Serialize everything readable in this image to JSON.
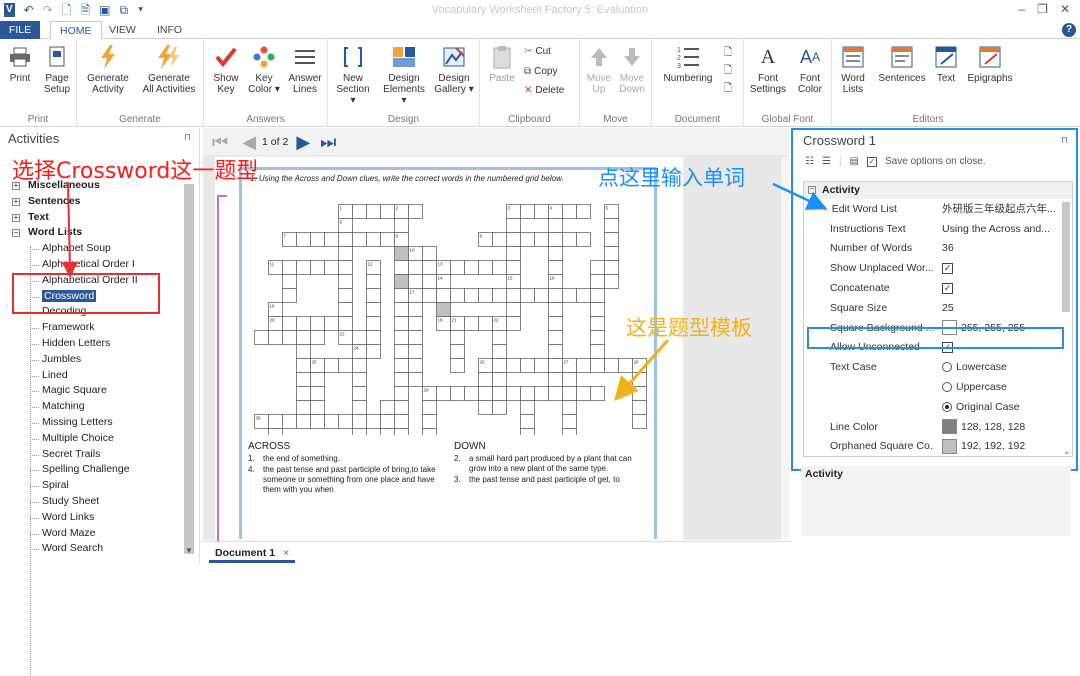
{
  "window": {
    "title": "Vocabulary Worksheet Factory 5: Evaluation"
  },
  "tabs": {
    "file": "FILE",
    "home": "HOME",
    "view": "VIEW",
    "info": "INFO"
  },
  "ribbon": {
    "print": {
      "label": "Print",
      "group": "Print"
    },
    "page_setup": {
      "line1": "Page",
      "line2": "Setup"
    },
    "generate_activity": {
      "line1": "Generate",
      "line2": "Activity"
    },
    "generate_all": {
      "line1": "Generate",
      "line2": "All Activities"
    },
    "generate_group": "Generate",
    "show_key": {
      "line1": "Show",
      "line2": "Key"
    },
    "key_color": {
      "line1": "Key",
      "line2": "Color ▾"
    },
    "answer_lines": {
      "line1": "Answer",
      "line2": "Lines"
    },
    "answers_group": "Answers",
    "new_section": {
      "line1": "New",
      "line2": "Section ▾"
    },
    "design_elements": {
      "line1": "Design",
      "line2": "Elements ▾"
    },
    "design_gallery": {
      "line1": "Design",
      "line2": "Gallery ▾"
    },
    "design_group": "Design",
    "paste": "Paste",
    "cut": "Cut",
    "copy": "Copy",
    "delete": "Delete",
    "clipboard_group": "Clipboard",
    "move_up": {
      "line1": "Move",
      "line2": "Up"
    },
    "move_down": {
      "line1": "Move",
      "line2": "Down"
    },
    "move_group": "Move",
    "numbering": "Numbering",
    "document_group": "Document",
    "font_settings": {
      "line1": "Font",
      "line2": "Settings"
    },
    "font_color": {
      "line1": "Font",
      "line2": "Color"
    },
    "global_font_group": "Global Font",
    "word_lists": {
      "line1": "Word",
      "line2": "Lists"
    },
    "sentences": "Sentences",
    "text": "Text",
    "epigraphs": "Epigraphs",
    "editors_group": "Editors"
  },
  "activities": {
    "title": "Activities",
    "top_nodes": [
      "Miscellaneous",
      "Sentences",
      "Text",
      "Word Lists"
    ],
    "items": [
      "Alphabet Soup",
      "Alphabetical Order I",
      "Alphabetical Order II",
      "Crossword",
      "Decoding",
      "Framework",
      "Hidden Letters",
      "Jumbles",
      "Lined",
      "Magic Square",
      "Matching",
      "Missing Letters",
      "Multiple Choice",
      "Secret Trails",
      "Spelling Challenge",
      "Spiral",
      "Study Sheet",
      "Word Links",
      "Word Maze",
      "Word Search"
    ],
    "selected": "Crossword"
  },
  "navigation": {
    "page": "1 of 2"
  },
  "worksheet": {
    "instructions": "1.   Using the Across and Down clues, write the correct words in the numbered grid below.",
    "across_title": "ACROSS",
    "down_title": "DOWN",
    "across": [
      {
        "n": "1.",
        "t": "the end of something."
      },
      {
        "n": "4.",
        "t": "the past tense and past participle of bring,to take someone or something from one place and have them with you when"
      }
    ],
    "down": [
      {
        "n": "2.",
        "t": "a small hard part produced by a plant that can grow into a new plant of the same type."
      },
      {
        "n": "3.",
        "t": "the past tense and past participle of get, to"
      }
    ]
  },
  "document_tab": "Document 1",
  "properties": {
    "title": "Crossword 1",
    "save_options": "Save options on close.",
    "category": "Activity",
    "rows": [
      {
        "name": "Edit Word List",
        "value": "外研版三年级起点六年..."
      },
      {
        "name": "Instructions Text",
        "value": "Using the Across and..."
      },
      {
        "name": "Number of Words",
        "value": "36"
      },
      {
        "name": "Show Unplaced Wor...",
        "value": "checked"
      },
      {
        "name": "Concatenate",
        "value": "checked"
      },
      {
        "name": "Square Size",
        "value": "25"
      },
      {
        "name": "Square Background ...",
        "value": "255, 255, 255"
      },
      {
        "name": "Allow Unconnected",
        "value": "checked"
      },
      {
        "name": "Text Case",
        "value": "Lowercase"
      },
      {
        "name": "",
        "value": "Uppercase"
      },
      {
        "name": "",
        "value": "Original Case"
      },
      {
        "name": "Line Color",
        "value": "128, 128, 128"
      },
      {
        "name": "Orphaned Square Co...",
        "value": "192, 192, 192"
      }
    ],
    "text_case_selected": "Original Case",
    "description_title": "Activity"
  },
  "annotations": {
    "select_type": "选择Crossword这一题型",
    "enter_words": "点这里输入单词",
    "template": "这是题型模板"
  },
  "colors": {
    "accent": "#2b579a",
    "highlight_box": "#2b8de0",
    "annotation_red": "#ff1a1a",
    "annotation_blue": "#1a8fff",
    "annotation_orange": "#f0b21a"
  }
}
